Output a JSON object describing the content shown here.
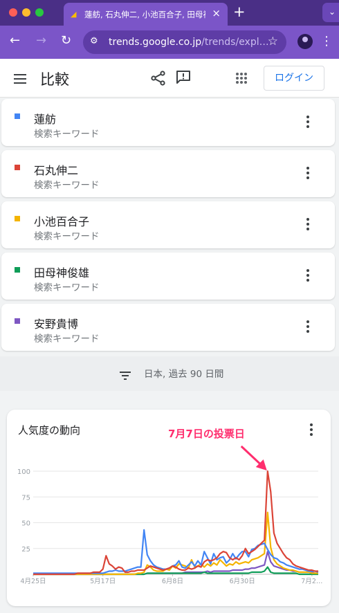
{
  "browser": {
    "tab_title": "蓮舫, 石丸伸二, 小池百合子, 田母神俊雄, 安野貴博",
    "url_host": "trends.google.co.jp",
    "url_path": "/trends/expl…",
    "new_tab": "+",
    "close": "×"
  },
  "header": {
    "title": "比較",
    "login_label": "ログイン"
  },
  "terms": [
    {
      "name": "蓮舫",
      "type": "検索キーワード",
      "color": "#4285f4"
    },
    {
      "name": "石丸伸二",
      "type": "検索キーワード",
      "color": "#db4437"
    },
    {
      "name": "小池百合子",
      "type": "検索キーワード",
      "color": "#f4b400"
    },
    {
      "name": "田母神俊雄",
      "type": "検索キーワード",
      "color": "#0f9d58"
    },
    {
      "name": "安野貴博",
      "type": "検索キーワード",
      "color": "#7e57c2"
    }
  ],
  "filter": {
    "label": "日本, 過去 90 日間"
  },
  "chart_card": {
    "title": "人気度の動向",
    "annotation": "7月7日の投票日"
  },
  "chart_data": {
    "type": "line",
    "ylim": [
      0,
      100
    ],
    "yticks": [
      "100",
      "75",
      "50",
      "25"
    ],
    "xtick_labels": [
      "4月25日",
      "5月17日",
      "6月8日",
      "6月30日",
      "7月2…"
    ],
    "xtick_index": [
      0,
      22,
      44,
      66,
      88
    ],
    "series": [
      {
        "name": "蓮舫",
        "color": "#4285f4",
        "values": [
          1,
          1,
          1,
          1,
          1,
          1,
          1,
          1,
          1,
          1,
          1,
          1,
          1,
          1,
          1,
          1,
          1,
          1,
          1,
          1,
          1,
          1,
          1,
          2,
          3,
          3,
          4,
          3,
          3,
          3,
          4,
          5,
          6,
          7,
          7,
          43,
          19,
          13,
          9,
          7,
          6,
          5,
          5,
          6,
          8,
          9,
          13,
          7,
          6,
          9,
          12,
          8,
          13,
          9,
          22,
          16,
          10,
          20,
          14,
          16,
          17,
          11,
          14,
          20,
          15,
          19,
          22,
          22,
          17,
          24,
          25,
          28,
          29,
          30,
          24,
          19,
          16,
          15,
          12,
          11,
          9,
          8,
          7,
          6,
          5,
          5,
          4,
          3,
          3,
          3,
          2
        ]
      },
      {
        "name": "石丸伸二",
        "color": "#db4437",
        "values": [
          0,
          0,
          0,
          0,
          0,
          0,
          0,
          0,
          0,
          0,
          0,
          0,
          0,
          0,
          1,
          1,
          1,
          1,
          1,
          2,
          2,
          2,
          5,
          18,
          10,
          8,
          5,
          7,
          6,
          2,
          2,
          3,
          3,
          4,
          4,
          4,
          6,
          8,
          7,
          6,
          5,
          4,
          5,
          6,
          8,
          7,
          5,
          4,
          4,
          6,
          5,
          6,
          8,
          7,
          12,
          14,
          13,
          14,
          16,
          20,
          22,
          21,
          16,
          14,
          16,
          14,
          18,
          25,
          20,
          22,
          24,
          27,
          30,
          33,
          100,
          80,
          40,
          30,
          25,
          20,
          16,
          14,
          10,
          8,
          7,
          6,
          5,
          4,
          4,
          3,
          3
        ]
      },
      {
        "name": "小池百合子",
        "color": "#f4b400",
        "values": [
          0,
          0,
          0,
          0,
          0,
          0,
          0,
          0,
          0,
          0,
          0,
          0,
          0,
          0,
          0,
          0,
          0,
          0,
          0,
          0,
          0,
          0,
          0,
          0,
          0,
          0,
          0,
          0,
          0,
          0,
          0,
          0,
          0,
          1,
          1,
          2,
          9,
          7,
          4,
          3,
          3,
          3,
          5,
          4,
          8,
          6,
          10,
          9,
          8,
          6,
          14,
          7,
          8,
          10,
          7,
          10,
          8,
          11,
          9,
          14,
          11,
          8,
          10,
          9,
          12,
          10,
          11,
          12,
          11,
          14,
          15,
          16,
          18,
          20,
          60,
          26,
          14,
          10,
          8,
          6,
          5,
          4,
          4,
          3,
          2,
          2,
          2,
          2,
          1,
          1,
          1
        ]
      },
      {
        "name": "田母神俊雄",
        "color": "#0f9d58",
        "values": [
          0,
          0,
          0,
          0,
          0,
          0,
          0,
          0,
          0,
          0,
          0,
          0,
          0,
          0,
          0,
          0,
          0,
          0,
          0,
          0,
          0,
          0,
          0,
          0,
          0,
          0,
          0,
          0,
          0,
          0,
          0,
          0,
          0,
          0,
          0,
          0,
          1,
          1,
          1,
          1,
          1,
          1,
          1,
          1,
          1,
          1,
          1,
          1,
          1,
          1,
          1,
          1,
          1,
          1,
          2,
          1,
          1,
          1,
          1,
          1,
          1,
          1,
          1,
          1,
          1,
          1,
          1,
          1,
          1,
          2,
          2,
          2,
          2,
          3,
          7,
          2,
          1,
          1,
          1,
          1,
          1,
          1,
          1,
          1,
          0,
          0,
          0,
          0,
          0,
          0,
          0
        ]
      },
      {
        "name": "安野貴博",
        "color": "#7e57c2",
        "values": [
          0,
          0,
          0,
          0,
          0,
          0,
          0,
          0,
          0,
          0,
          0,
          0,
          0,
          0,
          0,
          0,
          0,
          0,
          0,
          0,
          0,
          0,
          0,
          0,
          0,
          0,
          0,
          0,
          0,
          0,
          0,
          0,
          0,
          0,
          0,
          0,
          1,
          1,
          1,
          1,
          1,
          1,
          1,
          1,
          1,
          1,
          1,
          1,
          2,
          2,
          2,
          2,
          2,
          2,
          2,
          3,
          2,
          3,
          3,
          3,
          3,
          3,
          3,
          4,
          4,
          4,
          4,
          5,
          5,
          6,
          6,
          7,
          8,
          9,
          22,
          12,
          8,
          7,
          6,
          5,
          4,
          4,
          3,
          3,
          2,
          2,
          2,
          2,
          2,
          1,
          1
        ]
      }
    ]
  }
}
